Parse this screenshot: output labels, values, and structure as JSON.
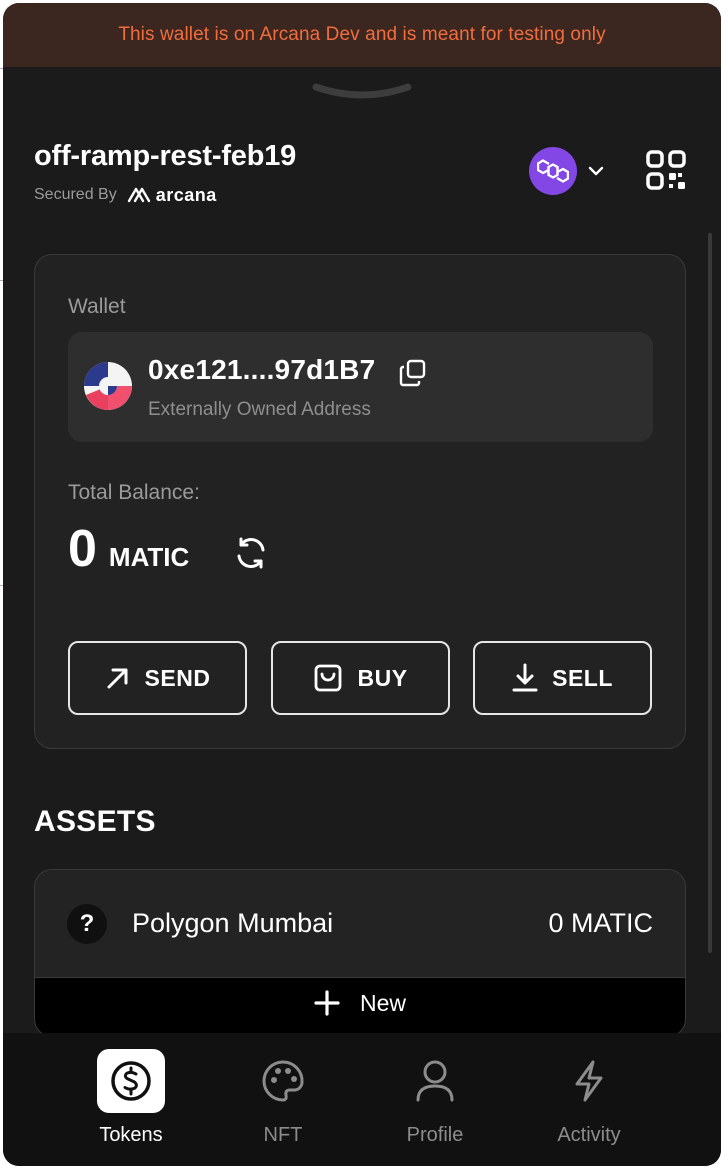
{
  "banner": {
    "text": "This wallet is on Arcana Dev and is meant for testing only"
  },
  "header": {
    "app_name": "off-ramp-rest-feb19",
    "secured_by": "Secured By",
    "brand": "arcana"
  },
  "wallet": {
    "label": "Wallet",
    "address": "0xe121....97d1B7",
    "address_type": "Externally Owned Address"
  },
  "balance": {
    "label": "Total Balance:",
    "amount": "0",
    "unit": "MATIC"
  },
  "actions": {
    "send": "SEND",
    "buy": "BUY",
    "sell": "SELL"
  },
  "assets": {
    "title": "ASSETS",
    "items": [
      {
        "name": "Polygon Mumbai",
        "balance": "0 MATIC",
        "icon": "question-icon"
      }
    ],
    "new_label": "New"
  },
  "nav": {
    "items": [
      {
        "label": "Tokens",
        "icon": "dollar-coin-icon",
        "active": true
      },
      {
        "label": "NFT",
        "icon": "palette-icon",
        "active": false
      },
      {
        "label": "Profile",
        "icon": "user-icon",
        "active": false
      },
      {
        "label": "Activity",
        "icon": "lightning-icon",
        "active": false
      }
    ]
  },
  "colors": {
    "banner_text": "#f26d3c",
    "banner_bg": "#3b2620",
    "polygon_purple": "#8247e5",
    "background": "#1b1b1b"
  }
}
